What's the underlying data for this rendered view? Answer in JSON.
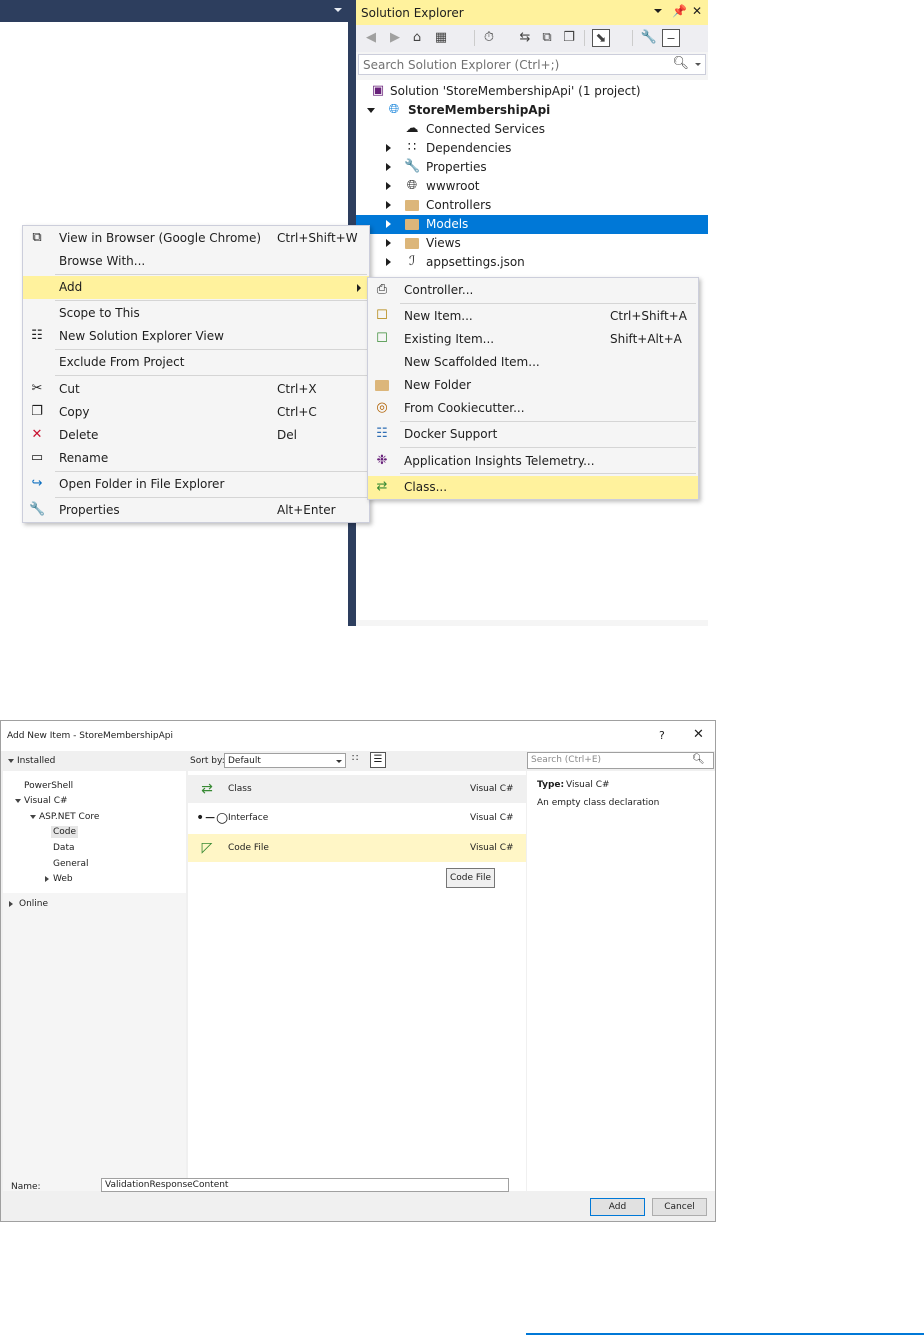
{
  "solution_explorer": {
    "title": "Solution Explorer",
    "pin_glyph": "⬇",
    "search_placeholder": "Search Solution Explorer (Ctrl+;)",
    "toolbar_icons": [
      "back-icon",
      "forward-icon",
      "home-icon",
      "switch-views-icon",
      "pending-changes-icon",
      "sync-icon",
      "collapse-all-icon",
      "show-all-files-icon",
      "preview-icon",
      "properties-icon",
      "pin-icon"
    ],
    "solution_label": "Solution 'StoreMembershipApi' (1 project)",
    "project_label": "StoreMembershipApi",
    "nodes": [
      {
        "label": "Connected Services"
      },
      {
        "label": "Dependencies"
      },
      {
        "label": "Properties"
      },
      {
        "label": "wwwroot"
      },
      {
        "label": "Controllers"
      },
      {
        "label": "Models"
      },
      {
        "label": "Views"
      },
      {
        "label": "appsettings.json"
      }
    ],
    "selected_color": "#0078d7",
    "title_color": "#fff29d"
  },
  "context_menu": {
    "items": [
      {
        "label": "View in Browser (Google Chrome)",
        "shortcut": "Ctrl+Shift+W"
      },
      {
        "label": "Browse With...",
        "shortcut": ""
      },
      {
        "label": "Add",
        "shortcut": ""
      },
      {
        "label": "Scope to This",
        "shortcut": ""
      },
      {
        "label": "New Solution Explorer View",
        "shortcut": ""
      },
      {
        "label": "Exclude From Project",
        "shortcut": ""
      },
      {
        "label": "Cut",
        "shortcut": "Ctrl+X"
      },
      {
        "label": "Copy",
        "shortcut": "Ctrl+C"
      },
      {
        "label": "Delete",
        "shortcut": "Del"
      },
      {
        "label": "Rename",
        "shortcut": ""
      },
      {
        "label": "Open Folder in File Explorer",
        "shortcut": ""
      },
      {
        "label": "Properties",
        "shortcut": "Alt+Enter"
      }
    ],
    "highlight_color": "#fff29d"
  },
  "add_submenu": {
    "items": [
      {
        "label": "Controller...",
        "shortcut": ""
      },
      {
        "label": "New Item...",
        "shortcut": "Ctrl+Shift+A"
      },
      {
        "label": "Existing Item...",
        "shortcut": "Shift+Alt+A"
      },
      {
        "label": "New Scaffolded Item...",
        "shortcut": ""
      },
      {
        "label": "New Folder",
        "shortcut": ""
      },
      {
        "label": "From Cookiecutter...",
        "shortcut": ""
      },
      {
        "label": "Docker Support",
        "shortcut": ""
      },
      {
        "label": "Application Insights Telemetry...",
        "shortcut": ""
      },
      {
        "label": "Class...",
        "shortcut": ""
      }
    ]
  },
  "dialog": {
    "title": "Add New Item - StoreMembershipApi",
    "help_glyph": "?",
    "close_glyph": "✕",
    "installed_label": "Installed",
    "tree": {
      "powershell": "PowerShell",
      "visual_csharp": "Visual C#",
      "aspnet_core": "ASP.NET Core",
      "code": "Code",
      "data": "Data",
      "general": "General",
      "web": "Web",
      "online": "Online"
    },
    "sort_by_label": "Sort by:",
    "sort_value": "Default",
    "search_placeholder": "Search (Ctrl+E)",
    "templates": [
      {
        "name": "Class",
        "lang": "Visual C#"
      },
      {
        "name": "Interface",
        "lang": "Visual C#"
      },
      {
        "name": "Code File",
        "lang": "Visual C#"
      }
    ],
    "tooltip": "Code File",
    "type_label": "Type:",
    "type_value": "Visual C#",
    "description": "An empty class declaration",
    "name_label": "Name:",
    "name_value": "ValidationResponseContent",
    "add_button": "Add",
    "cancel_button": "Cancel"
  }
}
